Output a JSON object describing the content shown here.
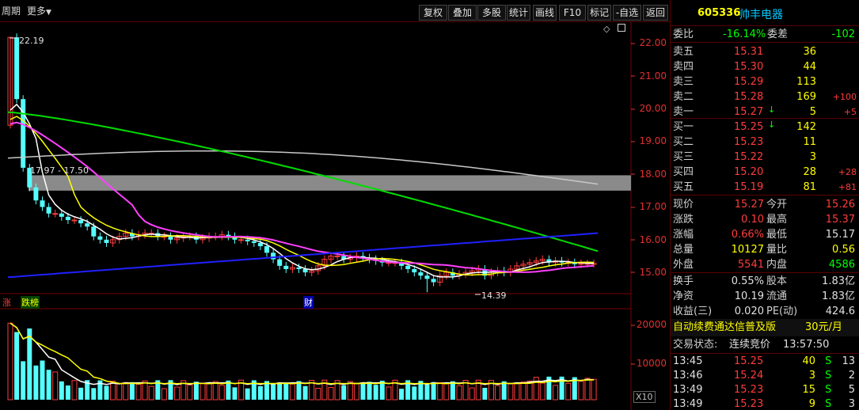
{
  "toolbar": {
    "left_items": [
      "周期",
      "更多"
    ],
    "buttons": [
      "复权",
      "叠加",
      "多股",
      "统计",
      "画线",
      "F10",
      "标记",
      "-自选",
      "返回"
    ]
  },
  "chart": {
    "price_axis": [
      "22.00",
      "21.00",
      "20.00",
      "19.00",
      "18.00",
      "17.00",
      "16.00",
      "15.00"
    ],
    "volume_axis": [
      "20000",
      "10000"
    ],
    "volume_unit": "X10",
    "high_label": "22.19",
    "low_label": "14.39",
    "gap_label": "17.97 - 17.50",
    "markers": [
      "涨",
      "跌榜",
      "财"
    ],
    "colors": {
      "up": "#ff3c3c",
      "down": "#54ffff",
      "ma5": "#ffffff",
      "ma10": "#ffff00",
      "ma20": "#ff40ff",
      "ma60": "#00dd00",
      "ma250": "#c8c8c8",
      "trend": "#2020ff"
    }
  },
  "quote": {
    "code": "605336",
    "name": "帅丰电器",
    "webi_label": "委比",
    "webi_value": "-16.14%",
    "weicha_label": "委差",
    "weicha_value": "-102",
    "asks": [
      {
        "label": "卖五",
        "price": "15.31",
        "vol": "36",
        "chg": ""
      },
      {
        "label": "卖四",
        "price": "15.30",
        "vol": "44",
        "chg": ""
      },
      {
        "label": "卖三",
        "price": "15.29",
        "vol": "113",
        "chg": ""
      },
      {
        "label": "卖二",
        "price": "15.28",
        "vol": "169",
        "chg": "+100"
      },
      {
        "label": "卖一",
        "price": "15.27",
        "vol": "5",
        "chg": "+5"
      }
    ],
    "bids": [
      {
        "label": "买一",
        "price": "15.25",
        "vol": "142",
        "chg": ""
      },
      {
        "label": "买二",
        "price": "15.23",
        "vol": "11",
        "chg": ""
      },
      {
        "label": "买三",
        "price": "15.22",
        "vol": "3",
        "chg": ""
      },
      {
        "label": "买四",
        "price": "15.20",
        "vol": "28",
        "chg": "+28"
      },
      {
        "label": "买五",
        "price": "15.19",
        "vol": "81",
        "chg": "+81"
      }
    ],
    "stats": [
      {
        "l1": "现价",
        "v1": "15.27",
        "l2": "今开",
        "v2": "15.26"
      },
      {
        "l1": "涨跌",
        "v1": "0.10",
        "l2": "最高",
        "v2": "15.37"
      },
      {
        "l1": "涨幅",
        "v1": "0.66%",
        "l2": "最低",
        "v2": "15.17"
      },
      {
        "l1": "总量",
        "v1": "10127",
        "l2": "量比",
        "v2": "0.56"
      },
      {
        "l1": "外盘",
        "v1": "5541",
        "l2": "内盘",
        "v2": "4586"
      }
    ],
    "stats2": [
      {
        "l1": "换手",
        "v1": "0.55%",
        "l2": "股本",
        "v2": "1.83亿"
      },
      {
        "l1": "净资",
        "v1": "10.19",
        "l2": "流通",
        "v2": "1.83亿"
      },
      {
        "l1": "收益(三)",
        "v1": "0.020",
        "l2": "PE(动)",
        "v2": "424.6"
      }
    ],
    "ad_text": "自动续费通达信普及版",
    "ad_price": "30元/月",
    "status_label": "交易状态:",
    "status_value": "连续竞价",
    "status_time": "13:57:50",
    "ticks": [
      {
        "time": "13:45",
        "price": "15.25",
        "vol": "40",
        "side": "S",
        "n": "13"
      },
      {
        "time": "13:46",
        "price": "15.24",
        "vol": "3",
        "side": "S",
        "n": "2"
      },
      {
        "time": "13:49",
        "price": "15.23",
        "vol": "15",
        "side": "S",
        "n": "5"
      },
      {
        "time": "13:49",
        "price": "15.23",
        "vol": "9",
        "side": "S",
        "n": "3"
      }
    ]
  }
}
